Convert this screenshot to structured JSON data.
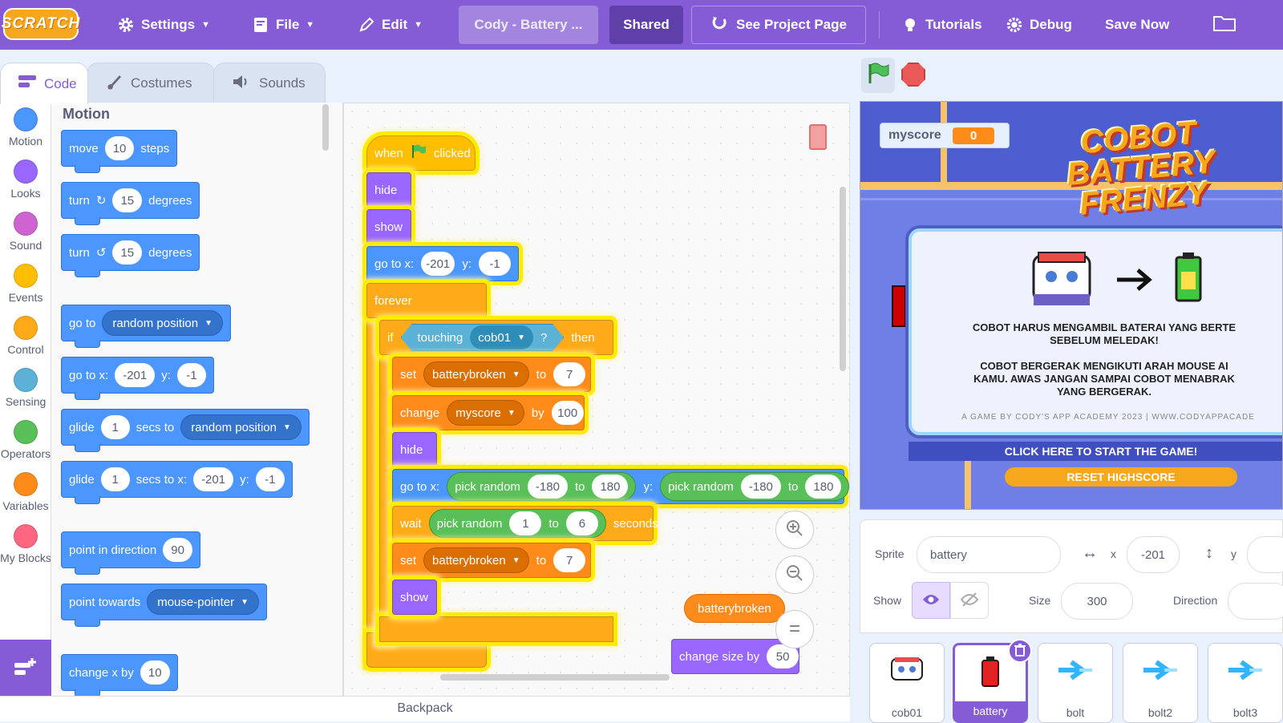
{
  "menubar": {
    "logo": "SCRATCH",
    "settings": "Settings",
    "file": "File",
    "edit": "Edit",
    "project_title": "Cody - Battery ...",
    "shared": "Shared",
    "see_project": "See Project Page",
    "tutorials": "Tutorials",
    "debug": "Debug",
    "save_now": "Save Now"
  },
  "tabs": {
    "code": "Code",
    "costumes": "Costumes",
    "sounds": "Sounds"
  },
  "categories": [
    {
      "label": "Motion",
      "color": "#4c97ff"
    },
    {
      "label": "Looks",
      "color": "#9966ff"
    },
    {
      "label": "Sound",
      "color": "#cf63cf"
    },
    {
      "label": "Events",
      "color": "#ffbf00"
    },
    {
      "label": "Control",
      "color": "#ffab19"
    },
    {
      "label": "Sensing",
      "color": "#5cb1d6"
    },
    {
      "label": "Operators",
      "color": "#59c059"
    },
    {
      "label": "Variables",
      "color": "#ff8c1a"
    },
    {
      "label": "My Blocks",
      "color": "#ff6680"
    }
  ],
  "palette": {
    "heading": "Motion",
    "move": {
      "a": "move",
      "v": "10",
      "b": "steps"
    },
    "turn_right": {
      "a": "turn",
      "v": "15",
      "b": "degrees"
    },
    "turn_left": {
      "a": "turn",
      "v": "15",
      "b": "degrees"
    },
    "goto": {
      "a": "go to",
      "dd": "random position"
    },
    "gotoxy": {
      "a": "go to x:",
      "x": "-201",
      "b": "y:",
      "y": "-1"
    },
    "glide": {
      "a": "glide",
      "v": "1",
      "b": "secs to",
      "dd": "random position"
    },
    "glidexy": {
      "a": "glide",
      "v": "1",
      "b": "secs to x:",
      "x": "-201",
      "c": "y:",
      "y": "-1"
    },
    "point_dir": {
      "a": "point in direction",
      "v": "90"
    },
    "point_towards": {
      "a": "point towards",
      "dd": "mouse-pointer"
    },
    "change_x": {
      "a": "change x by",
      "v": "10"
    }
  },
  "script": {
    "when": "when",
    "clicked": "clicked",
    "hide": "hide",
    "show": "show",
    "gotoxy": {
      "a": "go to x:",
      "x": "-201",
      "b": "y:",
      "y": "-1"
    },
    "forever": "forever",
    "if": "if",
    "then": "then",
    "touching": "touching",
    "touch_target": "cob01",
    "q": "?",
    "set1": {
      "a": "set",
      "var": "batterybroken",
      "b": "to",
      "v": "7"
    },
    "change": {
      "a": "change",
      "var": "myscore",
      "b": "by",
      "v": "100"
    },
    "hide2": "hide",
    "gotorand": {
      "a": "go to x:",
      "pick": "pick random",
      "x1": "-180",
      "to": "to",
      "x2": "180",
      "b": "y:",
      "y1": "-180",
      "y2": "180"
    },
    "wait": {
      "a": "wait",
      "pick": "pick random",
      "v1": "1",
      "to": "to",
      "v2": "6",
      "b": "seconds"
    },
    "set2": {
      "a": "set",
      "var": "batterybroken",
      "b": "to",
      "v": "7"
    },
    "show2": "show",
    "loose_var": "batterybroken",
    "change_size": {
      "a": "change size by",
      "v": "50"
    }
  },
  "backpack": "Backpack",
  "stage": {
    "monitor_label": "myscore",
    "monitor_value": "0",
    "game_title": [
      "COBOT",
      "BATTERY",
      "FRENZY"
    ],
    "line1": "COBOT HARUS MENGAMBIL BATERAI YANG BERTE",
    "line2": "SEBELUM MELEDAK!",
    "line3": "COBOT BERGERAK MENGIKUTI ARAH MOUSE AI",
    "line4": "KAMU. AWAS JANGAN SAMPAI COBOT MENABRAK",
    "line5": "YANG BERGERAK.",
    "footer": "A GAME BY CODY'S APP ACADEMY 2023   |   WWW.CODYAPPACADE",
    "start": "CLICK HERE TO START THE GAME!",
    "reset": "RESET HIGHSCORE"
  },
  "sprite_info": {
    "sprite_label": "Sprite",
    "sprite_name": "battery",
    "x_label": "x",
    "x": "-201",
    "y_label": "y",
    "show_label": "Show",
    "size_label": "Size",
    "size": "300",
    "direction_label": "Direction"
  },
  "sprites": [
    "cob01",
    "battery",
    "bolt",
    "bolt2",
    "bolt3"
  ]
}
